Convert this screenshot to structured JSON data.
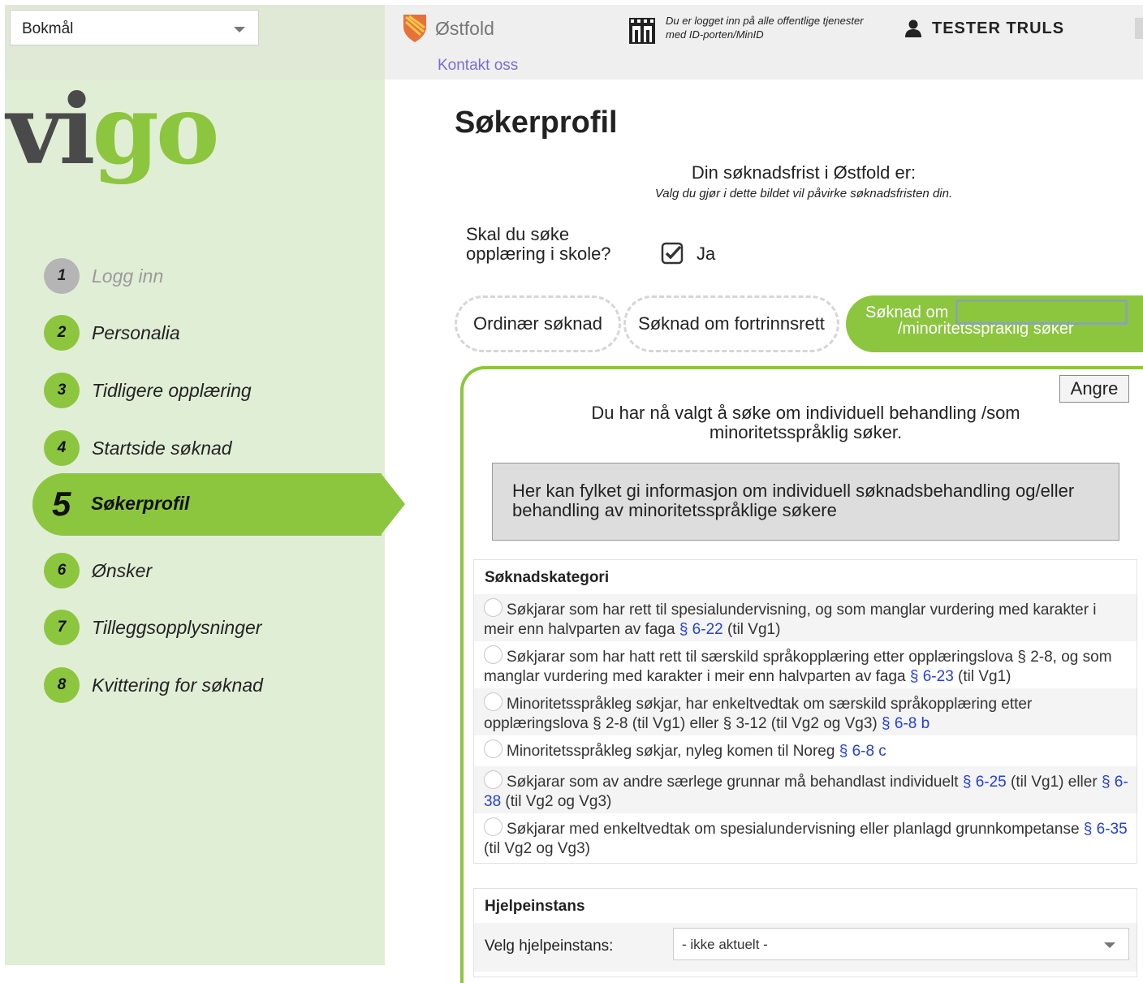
{
  "sidebar": {
    "language": "Bokmål",
    "logo_a": "vi",
    "logo_b": "go",
    "steps": [
      {
        "num": "1",
        "label": "Logg inn"
      },
      {
        "num": "2",
        "label": "Personalia"
      },
      {
        "num": "3",
        "label": "Tidligere opplæring"
      },
      {
        "num": "4",
        "label": "Startside søknad"
      },
      {
        "num": "5",
        "label": "Søkerprofil"
      },
      {
        "num": "6",
        "label": "Ønsker"
      },
      {
        "num": "7",
        "label": "Tilleggsopplysninger"
      },
      {
        "num": "8",
        "label": "Kvittering for søknad"
      }
    ]
  },
  "header": {
    "county": "Østfold",
    "contact": "Kontakt oss",
    "login_text": "Du er logget inn på alle offentlige tjenester med ID-porten/MinID",
    "user": "TESTER TRULS"
  },
  "main": {
    "title": "Søkerprofil",
    "deadline": "Din søknadsfrist i Østfold er:",
    "deadline_note": "Valg du gjør i dette bildet vil påvirke søknadsfristen din.",
    "school_question": "Skal du søke opplæring i skole?",
    "school_answer": "Ja",
    "tabs": {
      "ordinary": "Ordinær søknad",
      "priority": "Søknad om fortrinnsrett",
      "individual_l1": "Søknad om",
      "individual_l2": "/minoritetsspråklig søker"
    },
    "undo": "Angre",
    "choice_text": "Du har nå valgt å søke om individuell behandling /som minoritetsspråklig søker.",
    "info": "Her kan fylket gi informasjon om individuell søknadsbehandling og/eller behandling av minoritetsspråklige søkere"
  },
  "category": {
    "heading": "Søknadskategori",
    "items": [
      {
        "text": "Søkjarar som har rett til spesialundervisning, og som manglar vurdering med karakter i meir enn halvparten av faga",
        "law": "§ 6-22",
        "after": " (til Vg1)"
      },
      {
        "text": "Søkjarar som har hatt rett til særskild språkopplæring etter opplæringslova § 2-8, og som manglar vurdering med karakter i meir enn halvparten av faga",
        "law": "§ 6-23",
        "after": " (til Vg1)"
      },
      {
        "text": "Minoritetsspråkleg søkjar, har enkeltvedtak om særskild språkopplæring etter opplæringslova § 2-8 (til Vg1) eller § 3-12 (til Vg2 og Vg3)",
        "law": "§ 6-8 b",
        "after": ""
      },
      {
        "text": "Minoritetsspråkleg søkjar, nyleg komen til Noreg",
        "law": "§ 6-8 c",
        "after": ""
      },
      {
        "text": "Søkjarar som av andre særlege grunnar må behandlast individuelt",
        "law": "§ 6-25",
        "after": " (til Vg1) eller",
        "law2": "§ 6-38",
        "after2": " (til Vg2 og Vg3)"
      },
      {
        "text": "Søkjarar med enkeltvedtak om spesialundervisning eller planlagd grunnkompetanse",
        "law": "§ 6-35",
        "after": " (til Vg2 og Vg3)"
      }
    ]
  },
  "help": {
    "heading": "Hjelpeinstans",
    "label": "Velg hjelpeinstans:",
    "value": "- ikke aktuelt -"
  },
  "colors": {
    "brand_green": "#8cc63f",
    "link": "#2340d8"
  }
}
